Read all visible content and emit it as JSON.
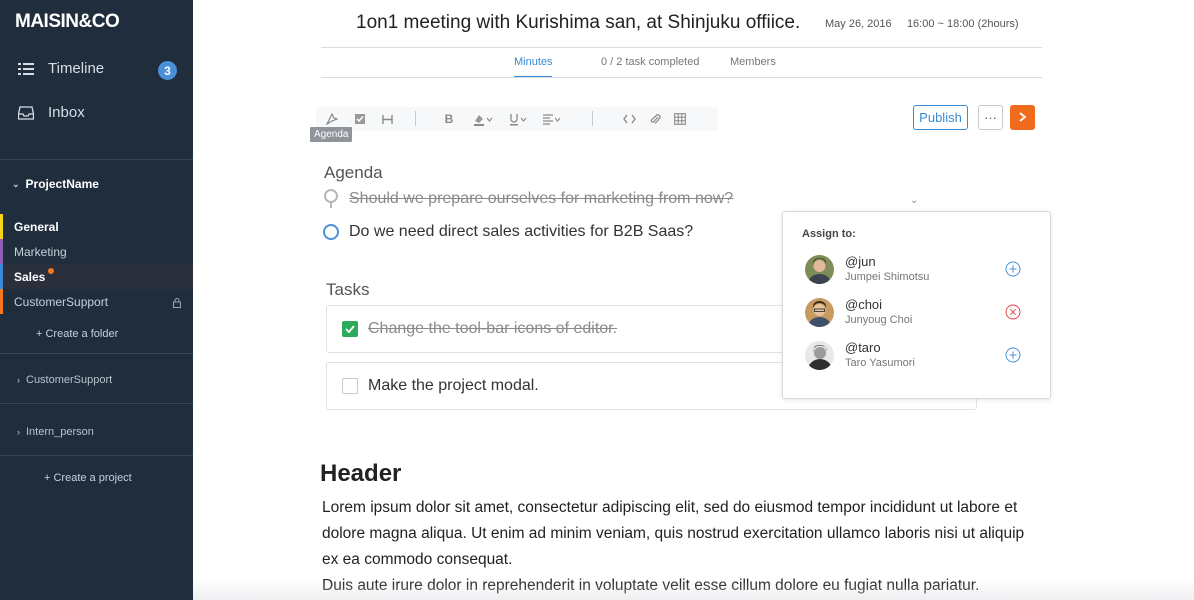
{
  "app": {
    "brand": "MAISIN&CO"
  },
  "nav": {
    "timeline_label": "Timeline",
    "timeline_badge": "3",
    "inbox_label": "Inbox"
  },
  "project": {
    "name": "ProjectName",
    "folders": [
      {
        "label": "General",
        "color": "#f5d316"
      },
      {
        "label": "Marketing",
        "color": "#8e5fb5"
      },
      {
        "label": "Sales",
        "color": "#3a8ad6"
      },
      {
        "label": "CustomerSupport",
        "color": "#f5781e"
      }
    ],
    "create_folder_label": "+ Create a folder"
  },
  "other_projects": [
    "CustomerSupport",
    "Intern_person"
  ],
  "create_project_label": "+ Create a project",
  "meeting": {
    "title": "1on1 meeting with Kurishima san, at Shinjuku offiice.",
    "date": "May 26, 2016",
    "time": "16:00 ~ 18:00 (2hours)"
  },
  "tabs": {
    "minutes": "Minutes",
    "tasks": "0 / 2 task completed",
    "members": "Members"
  },
  "toolbar": {
    "tooltip": "Agenda",
    "publish_label": "Publish",
    "more_label": "···"
  },
  "agenda": {
    "heading": "Agenda",
    "items": [
      {
        "text": "Should we prepare ourselves for marketing from now?",
        "done": true
      },
      {
        "text": "Do we need direct sales activities for B2B Saas?",
        "done": false
      }
    ]
  },
  "tasks": {
    "heading": "Tasks",
    "items": [
      {
        "text": "Change the tool-bar icons of editor.",
        "checked": true
      },
      {
        "text": "Make the project modal.",
        "checked": false
      }
    ]
  },
  "document": {
    "header": "Header",
    "paragraph1": "Lorem ipsum dolor sit amet, consectetur adipiscing elit, sed do eiusmod tempor incididunt ut labore et dolore magna aliqua. Ut enim ad minim veniam, quis nostrud exercitation ullamco laboris nisi ut aliquip ex ea commodo consequat.",
    "paragraph2": "Duis aute irure dolor in reprehenderit in voluptate velit esse cillum dolore eu fugiat nulla pariatur."
  },
  "assign_popover": {
    "title": "Assign to:",
    "people": [
      {
        "handle": "@jun",
        "name": "Jumpei Shimotsu",
        "action": "add"
      },
      {
        "handle": "@choi",
        "name": "Junyoug Choi",
        "action": "remove"
      },
      {
        "handle": "@taro",
        "name": "Taro Yasumori",
        "action": "add"
      }
    ]
  },
  "colors": {
    "sidebar_bg": "#1f2d3d",
    "accent_blue": "#3a8ad6",
    "accent_orange": "#f26a1b",
    "task_done_green": "#2eaa5c",
    "remove_red": "#e0474c"
  }
}
